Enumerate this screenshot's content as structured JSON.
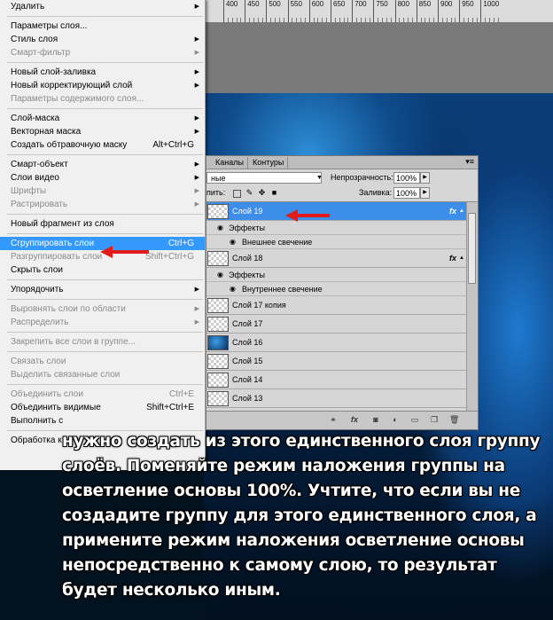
{
  "ruler": {
    "labels": [
      "400",
      "450",
      "500",
      "550",
      "600",
      "650",
      "700",
      "750",
      "800",
      "850",
      "900",
      "950",
      "1000"
    ]
  },
  "colors": {
    "menu_highlight": "#3399ff",
    "selected_layer": "#3d8ee8",
    "arrow": "#e21b1b",
    "menu_bg": "#f0f0f0"
  },
  "menu": {
    "items": [
      {
        "label": "Удалить",
        "shortcut": "",
        "submenu": true,
        "disabled": false,
        "selected": false
      },
      {
        "separator": true
      },
      {
        "label": "Параметры слоя...",
        "shortcut": "",
        "submenu": false,
        "disabled": false,
        "selected": false
      },
      {
        "label": "Стиль слоя",
        "shortcut": "",
        "submenu": true,
        "disabled": false,
        "selected": false
      },
      {
        "label": "Смарт-фильтр",
        "shortcut": "",
        "submenu": true,
        "disabled": true,
        "selected": false
      },
      {
        "separator": true
      },
      {
        "label": "Новый слой-заливка",
        "shortcut": "",
        "submenu": true,
        "disabled": false,
        "selected": false
      },
      {
        "label": "Новый корректирующий слой",
        "shortcut": "",
        "submenu": true,
        "disabled": false,
        "selected": false
      },
      {
        "label": "Параметры содержимого слоя...",
        "shortcut": "",
        "submenu": false,
        "disabled": true,
        "selected": false
      },
      {
        "separator": true
      },
      {
        "label": "Слой-маска",
        "shortcut": "",
        "submenu": true,
        "disabled": false,
        "selected": false
      },
      {
        "label": "Векторная маска",
        "shortcut": "",
        "submenu": true,
        "disabled": false,
        "selected": false
      },
      {
        "label": "Создать обтравочную маску",
        "shortcut": "Alt+Ctrl+G",
        "submenu": false,
        "disabled": false,
        "selected": false
      },
      {
        "separator": true
      },
      {
        "label": "Смарт-объект",
        "shortcut": "",
        "submenu": true,
        "disabled": false,
        "selected": false
      },
      {
        "label": "Слои видео",
        "shortcut": "",
        "submenu": true,
        "disabled": false,
        "selected": false
      },
      {
        "label": "Шрифты",
        "shortcut": "",
        "submenu": true,
        "disabled": true,
        "selected": false
      },
      {
        "label": "Растрировать",
        "shortcut": "",
        "submenu": true,
        "disabled": true,
        "selected": false
      },
      {
        "separator": true
      },
      {
        "label": "Новый фрагмент из слоя",
        "shortcut": "",
        "submenu": false,
        "disabled": false,
        "selected": false
      },
      {
        "separator": true
      },
      {
        "label": "Сгруппировать слои",
        "shortcut": "Ctrl+G",
        "submenu": false,
        "disabled": false,
        "selected": true
      },
      {
        "label": "Разгруппировать слои",
        "shortcut": "Shift+Ctrl+G",
        "submenu": false,
        "disabled": true,
        "selected": false
      },
      {
        "label": "Скрыть слои",
        "shortcut": "",
        "submenu": false,
        "disabled": false,
        "selected": false
      },
      {
        "separator": true
      },
      {
        "label": "Упорядочить",
        "shortcut": "",
        "submenu": true,
        "disabled": false,
        "selected": false
      },
      {
        "separator": true
      },
      {
        "label": "Выровнять слои по области",
        "shortcut": "",
        "submenu": true,
        "disabled": true,
        "selected": false
      },
      {
        "label": "Распределить",
        "shortcut": "",
        "submenu": true,
        "disabled": true,
        "selected": false
      },
      {
        "separator": true
      },
      {
        "label": "Закрепить все слои в группе...",
        "shortcut": "",
        "submenu": false,
        "disabled": true,
        "selected": false
      },
      {
        "separator": true
      },
      {
        "label": "Связать слои",
        "shortcut": "",
        "submenu": false,
        "disabled": true,
        "selected": false
      },
      {
        "label": "Выделить связанные слои",
        "shortcut": "",
        "submenu": false,
        "disabled": true,
        "selected": false
      },
      {
        "separator": true
      },
      {
        "label": "Объединить слои",
        "shortcut": "Ctrl+E",
        "submenu": false,
        "disabled": true,
        "selected": false
      },
      {
        "label": "Объединить видимые",
        "shortcut": "Shift+Ctrl+E",
        "submenu": false,
        "disabled": false,
        "selected": false
      },
      {
        "label": "Выполнить с",
        "shortcut": "",
        "submenu": false,
        "disabled": false,
        "selected": false
      },
      {
        "separator": true
      },
      {
        "label": "Обработка к",
        "shortcut": "",
        "submenu": false,
        "disabled": false,
        "selected": false
      }
    ]
  },
  "panel": {
    "tabs": [
      "Каналы",
      "Контуры"
    ],
    "menu_glyph": "▾≡",
    "blend_mode": "ные",
    "opacity_label": "Непрозрачность:",
    "opacity_value": "100%",
    "lock_label": "пить:",
    "fill_label": "Заливка:",
    "fill_value": "100%",
    "rows": [
      {
        "kind": "layer",
        "name": "Слой 19",
        "fx": true,
        "selected": true,
        "thumb": "transparent"
      },
      {
        "kind": "fx-header",
        "text": "Эффекты"
      },
      {
        "kind": "fx-item",
        "text": "Внешнее свечение"
      },
      {
        "kind": "layer",
        "name": "Слой 18",
        "fx": true,
        "selected": false,
        "thumb": "transparent"
      },
      {
        "kind": "fx-header",
        "text": "Эффекты"
      },
      {
        "kind": "fx-item",
        "text": "Внутреннее свечение"
      },
      {
        "kind": "layer",
        "name": "Слой 17 копия",
        "fx": false,
        "selected": false,
        "thumb": "transparent"
      },
      {
        "kind": "layer",
        "name": "Слой 17",
        "fx": false,
        "selected": false,
        "thumb": "transparent"
      },
      {
        "kind": "layer",
        "name": "Слой 16",
        "fx": false,
        "selected": false,
        "thumb": "image"
      },
      {
        "kind": "layer",
        "name": "Слой 15",
        "fx": false,
        "selected": false,
        "thumb": "transparent"
      },
      {
        "kind": "layer",
        "name": "Слой 14",
        "fx": false,
        "selected": false,
        "thumb": "transparent"
      },
      {
        "kind": "layer",
        "name": "Слой 13",
        "fx": false,
        "selected": false,
        "thumb": "transparent"
      }
    ],
    "fx_glyph": "fx"
  },
  "caption": {
    "text": "нужно создать из этого единственного слоя группу слоёв. Поменяйте режим наложения группы на осветление основы 100%. Учтите, что если вы не создадите группу для этого единственного слоя, а примените режим наложения осветление основы непосредственно к самому слою, то результат будет несколько иным."
  }
}
